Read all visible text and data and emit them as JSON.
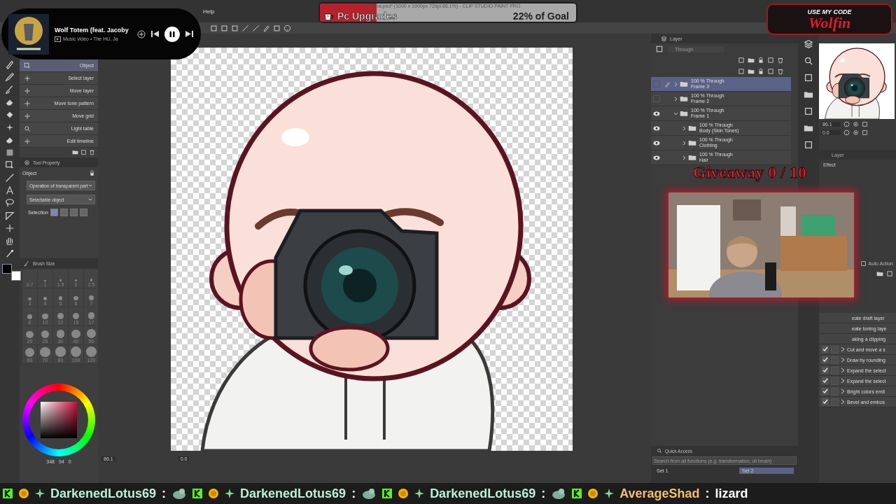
{
  "media_player": {
    "title": "Wolf Totem (feat. Jacoby",
    "subtitle": "Music video • The HU, Ja",
    "playing": true
  },
  "menu": [
    {
      "label": "Help"
    }
  ],
  "window_title": "Camera.psd* (1000 x 1000px 72dpi 86.1%)  - CLIP STUDIO PAINT PRO",
  "goal": {
    "label": "Pc Upgrades",
    "reading": "22% of Goal",
    "level": 0.22
  },
  "code_badge": {
    "caption": "USE MY CODE",
    "code": "Wolfin"
  },
  "sub_tools": [
    {
      "label": "Object",
      "selected": true
    },
    {
      "label": "Select layer",
      "selected": false
    },
    {
      "label": "Move layer",
      "selected": false
    },
    {
      "label": "Move tone pattern",
      "selected": false
    },
    {
      "label": "Move grid",
      "selected": false
    },
    {
      "label": "Light table",
      "selected": false
    },
    {
      "label": "Edit timeline",
      "selected": false
    }
  ],
  "tool_property": {
    "title": "Tool Property",
    "section": "Object",
    "dropdowns": [
      "Operation of transparent part",
      "Selectable object"
    ],
    "selection_label": "Selection"
  },
  "brush_size": {
    "title": "Brush Size",
    "sizes": [
      "0.7",
      "1",
      "1.5",
      "2",
      "2.5",
      "3",
      "4",
      "5",
      "6",
      "7",
      "8",
      "10",
      "12",
      "15",
      "17",
      "20",
      "25",
      "30",
      "40",
      "50",
      "60",
      "70",
      "80",
      "100",
      "120"
    ]
  },
  "color_readouts": [
    "348",
    "94",
    "0"
  ],
  "canvas_status": {
    "zoom": "86.1",
    "angle": "0.0"
  },
  "layer_panel": {
    "tab": "Layer",
    "blend_mode": "Through",
    "layers": [
      {
        "mode": "100 % Through",
        "name": "Frame 3",
        "visible": false,
        "selected": true,
        "expanded": false
      },
      {
        "mode": "100 % Through",
        "name": "Frame 2",
        "visible": false,
        "selected": false,
        "expanded": false
      },
      {
        "mode": "100 % Through",
        "name": "Frame 1",
        "visible": true,
        "selected": false,
        "expanded": true,
        "children": [
          {
            "mode": "100 % Through",
            "name": "Body (Skin Tones)",
            "visible": true,
            "selected": false,
            "expanded": false
          },
          {
            "mode": "100 % Through",
            "name": "Clothing",
            "visible": true,
            "selected": false,
            "expanded": false
          },
          {
            "mode": "100 % Through",
            "name": "Hair",
            "visible": true,
            "selected": false,
            "expanded": false
          }
        ]
      }
    ]
  },
  "navigator": {
    "zoom": "86.1",
    "angle": "0.0"
  },
  "layer_property": {
    "tab": "Layer",
    "section": "Effect"
  },
  "giveaway": "Giveaway 0 / 10",
  "auto_action": {
    "title": "Auto Action",
    "items": [
      {
        "kind": "partial",
        "label": "eate draft layer"
      },
      {
        "kind": "partial",
        "label": "eate toning laye"
      },
      {
        "kind": "partial",
        "label": "aking a clipping"
      },
      {
        "kind": "full",
        "label": "Cut and move a s",
        "checked": true,
        "dialog": false
      },
      {
        "kind": "full",
        "label": "Draw by rounding",
        "checked": true,
        "dialog": false
      },
      {
        "kind": "full",
        "label": "Expand the select",
        "checked": true,
        "dialog": false
      },
      {
        "kind": "full",
        "label": "Expand the select",
        "checked": true,
        "dialog": false
      },
      {
        "kind": "full",
        "label": "Bright colors emit",
        "checked": true,
        "dialog": false
      },
      {
        "kind": "full",
        "label": "Bevel and embos",
        "checked": true,
        "dialog": false
      }
    ]
  },
  "quick_access": {
    "title": "Quick Access",
    "placeholder": "Search from all functions (e.g. transformation, oil brush)",
    "sets": [
      {
        "label": "Set 1",
        "selected": false
      },
      {
        "label": "Set 2",
        "selected": true
      }
    ]
  },
  "chat_ticker": [
    {
      "name": "DarkenedLotus69",
      "suffix": ":",
      "color": "#b8f2d6"
    },
    {
      "name": "DarkenedLotus69",
      "suffix": ":",
      "color": "#b8f2d6"
    },
    {
      "name": "DarkenedLotus69",
      "suffix": ":",
      "color": "#b8f2d6"
    },
    {
      "name": "AverageShad",
      "suffix": ":",
      "color": "#f5bf6a",
      "message": "lizard"
    }
  ]
}
